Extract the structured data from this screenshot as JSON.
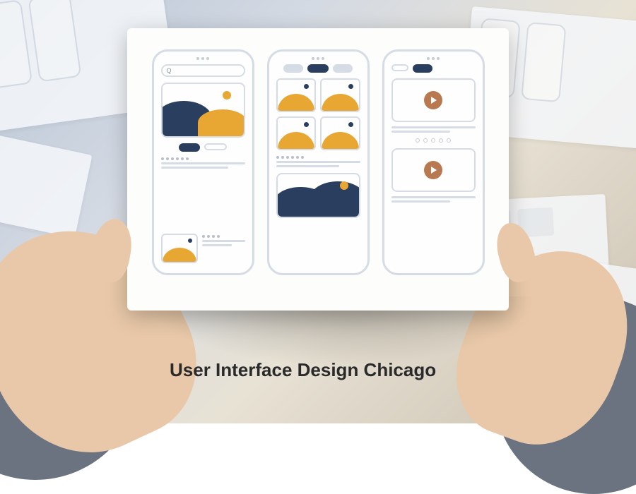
{
  "caption": "User Interface Design Chicago",
  "search": {
    "placeholder": "Q"
  },
  "colors": {
    "navy": "#2a3f5f",
    "yellow": "#e8a633",
    "outline": "#d5dce5",
    "brown": "#b87850"
  },
  "mockups": {
    "phone1": {
      "type": "search-gallery"
    },
    "phone2": {
      "type": "grid-gallery"
    },
    "phone3": {
      "type": "video-list"
    }
  }
}
